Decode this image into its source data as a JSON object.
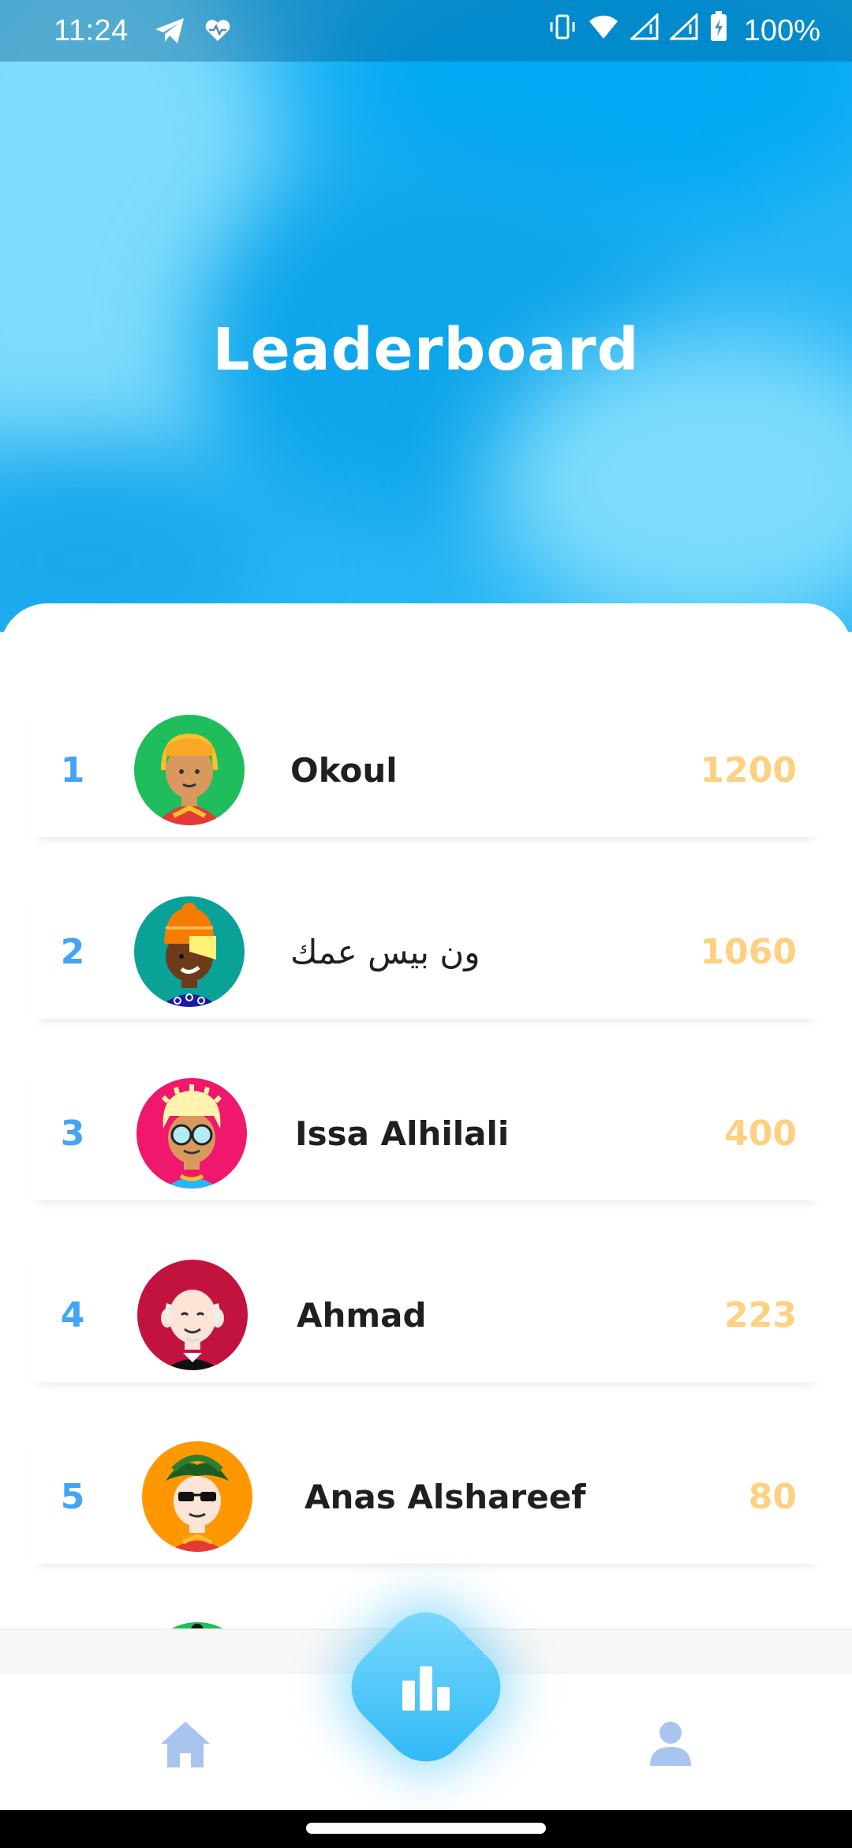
{
  "status_bar": {
    "time": "11:24",
    "battery": "100%",
    "icons": [
      "telegram-icon",
      "heart-pulse-icon",
      "vibrate-icon",
      "wifi-icon",
      "signal-icon",
      "signal-icon",
      "battery-charging-icon"
    ]
  },
  "header": {
    "title": "Leaderboard"
  },
  "leaderboard": [
    {
      "rank": "1",
      "name": "Okoul",
      "score": "1200",
      "avatar_bg": "#1fbd5c"
    },
    {
      "rank": "2",
      "name": "ون بيس عمك",
      "score": "1060",
      "avatar_bg": "#0aa197"
    },
    {
      "rank": "3",
      "name": "Issa Alhilali",
      "score": "400",
      "avatar_bg": "#f0186c"
    },
    {
      "rank": "4",
      "name": "Ahmad",
      "score": "223",
      "avatar_bg": "#c2123e"
    },
    {
      "rank": "5",
      "name": "Anas Alshareef",
      "score": "80",
      "avatar_bg": "#ff9800"
    }
  ],
  "nav": {
    "items": [
      "home-icon",
      "leaderboard-icon",
      "profile-icon"
    ],
    "active": "leaderboard"
  },
  "colors": {
    "accent": "#29b6f6",
    "rank": "#42a5f5",
    "score": "#fcd182",
    "nav_inactive": "#aac4f0"
  }
}
